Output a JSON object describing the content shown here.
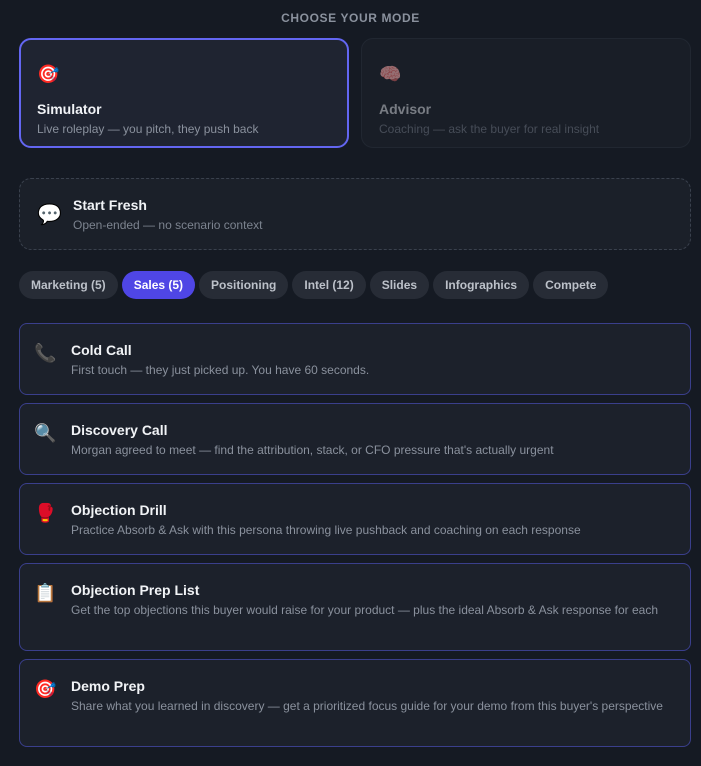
{
  "heading": "CHOOSE YOUR MODE",
  "modes": [
    {
      "emoji": "🎯",
      "title": "Simulator",
      "desc": "Live roleplay — you pitch, they push back"
    },
    {
      "emoji": "🧠",
      "title": "Advisor",
      "desc": "Coaching — ask the buyer for real insight"
    }
  ],
  "fresh": {
    "emoji": "💬",
    "title": "Start Fresh",
    "desc": "Open-ended — no scenario context"
  },
  "tabs": [
    "Marketing (5)",
    "Sales (5)",
    "Positioning",
    "Intel (12)",
    "Slides",
    "Infographics",
    "Compete"
  ],
  "active_tab": "Sales (5)",
  "scenarios": [
    {
      "emoji": "📞",
      "title": "Cold Call",
      "desc": "First touch — they just picked up. You have 60 seconds."
    },
    {
      "emoji": "🔍",
      "title": "Discovery Call",
      "desc": "Morgan agreed to meet — find the attribution, stack, or CFO pressure that's actually urgent"
    },
    {
      "emoji": "🥊",
      "title": "Objection Drill",
      "desc": "Practice Absorb & Ask with this persona throwing live pushback and coaching on each response"
    },
    {
      "emoji": "📋",
      "title": "Objection Prep List",
      "desc": "Get the top objections this buyer would raise for your product — plus the ideal Absorb & Ask response for each"
    },
    {
      "emoji": "🎯",
      "title": "Demo Prep",
      "desc": "Share what you learned in discovery — get a prioritized focus guide for your demo from this buyer's perspective"
    }
  ],
  "colors": {
    "accent": "#4f46e5",
    "accent_border": "#6366f1",
    "background": "#151a23",
    "card": "#1d222c"
  }
}
